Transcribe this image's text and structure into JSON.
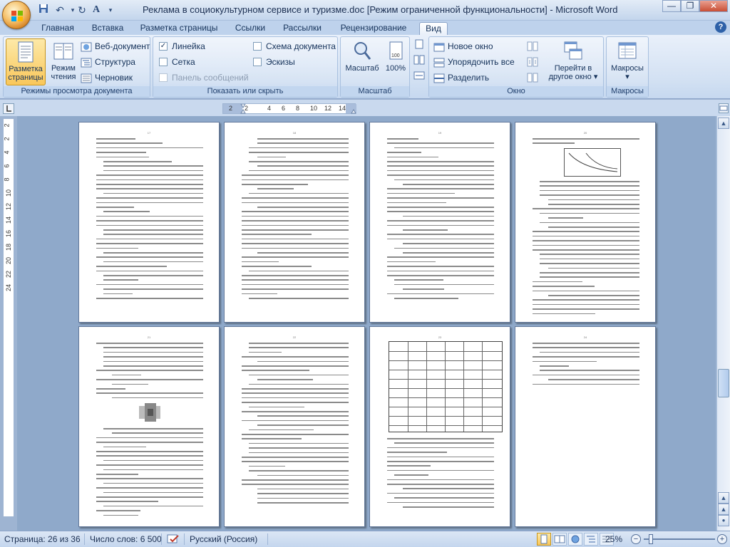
{
  "window": {
    "title": "Реклама в социокультурном сервисе и туризме.doc [Режим ограниченной функциональности] - Microsoft Word",
    "controls": {
      "minimize": "—",
      "restore": "❐",
      "close": "✕"
    }
  },
  "qat": {
    "save_icon": "save-icon",
    "undo_icon": "undo-icon",
    "redo_icon": "redo-icon",
    "format_icon": "format-painter-icon"
  },
  "tabs": [
    {
      "label": "Главная"
    },
    {
      "label": "Вставка"
    },
    {
      "label": "Разметка страницы"
    },
    {
      "label": "Ссылки"
    },
    {
      "label": "Рассылки"
    },
    {
      "label": "Рецензирование"
    },
    {
      "label": "Вид"
    }
  ],
  "active_tab": "Вид",
  "ribbon": {
    "views": {
      "group_label": "Режимы просмотра документа",
      "print_layout_line1": "Разметка",
      "print_layout_line2": "страницы",
      "reading_line1": "Режим",
      "reading_line2": "чтения",
      "web": "Веб-документ",
      "outline": "Структура",
      "draft": "Черновик"
    },
    "show_hide": {
      "group_label": "Показать или скрыть",
      "ruler": "Линейка",
      "ruler_checked": true,
      "grid": "Сетка",
      "grid_checked": false,
      "message_bar": "Панель сообщений",
      "doc_map": "Схема документа",
      "doc_map_checked": false,
      "thumbnails": "Эскизы",
      "thumbnails_checked": false
    },
    "zoom": {
      "group_label": "Масштаб",
      "zoom": "Масштаб",
      "hundred": "100%"
    },
    "window": {
      "group_label": "Окно",
      "new_window": "Новое окно",
      "arrange_all": "Упорядочить все",
      "split": "Разделить",
      "switch_line1": "Перейти в",
      "switch_line2": "другое окно",
      "switch_arrow": "▾"
    },
    "macros": {
      "group_label": "Макросы",
      "macros": "Макросы",
      "arrow": "▾"
    }
  },
  "ruler": {
    "h_ticks": [
      "2",
      "2",
      "4",
      "6",
      "8",
      "10",
      "12",
      "14"
    ],
    "v_ticks": [
      "2",
      "2",
      "4",
      "6",
      "8",
      "10",
      "12",
      "14",
      "16",
      "18",
      "20",
      "22",
      "24"
    ]
  },
  "pages": [
    {
      "num": "17"
    },
    {
      "num": "18"
    },
    {
      "num": "19"
    },
    {
      "num": "20"
    },
    {
      "num": "21"
    },
    {
      "num": "22"
    },
    {
      "num": "23"
    },
    {
      "num": "24"
    }
  ],
  "status": {
    "page": "Страница: 26 из 36",
    "words": "Число слов: 6 500",
    "language": "Русский (Россия)",
    "zoom": "25%",
    "minus": "−",
    "plus": "+"
  }
}
